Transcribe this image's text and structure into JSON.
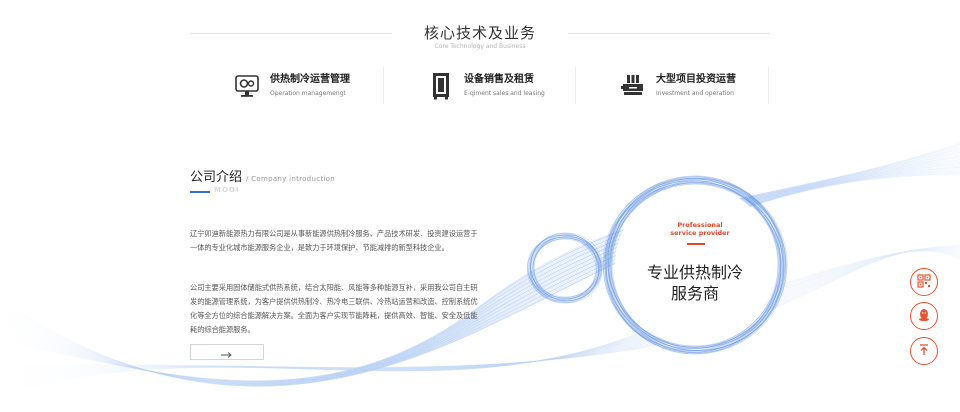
{
  "core": {
    "title": "核心技术及业务",
    "subtitle": "Core Technology and Business"
  },
  "services": [
    {
      "title": "供热制冷运营管理",
      "en": "Operation managemengt",
      "icon": "gear-monitor-icon"
    },
    {
      "title": "设备销售及租赁",
      "en": "E-qiment sales and leasing",
      "icon": "cabinet-icon"
    },
    {
      "title": "大型项目投资运营",
      "en": "Investment and operation",
      "icon": "machine-icon"
    }
  ],
  "intro": {
    "title": "公司介绍",
    "title_en": "/ Company introduction",
    "more_label": "MOOI",
    "para1": "辽宁卯迪新能源热力有限公司是从事新能源供热制冷服务、产品技术研发、投资建设运营于一体的专业化城市能源服务企业，是致力于环境保护、节能减排的新型科技企业。",
    "para2": "公司主要采用固体储能式供热系统，结合太阳能、风能等多种能源互补，采用我公司自主研发的能源管理系统，为客户提供供热制冷、热冷电三联供、冷热站运营和改造、控制系统优化等全方位的综合能源解决方案。全面为客户实现节能降耗，提供高效、智能、安全及低能耗的综合能源服务。",
    "button_icon": "arrow-right-icon"
  },
  "badge": {
    "en_line1": "Professional",
    "en_line2": "service provider",
    "cn_line1": "专业供热制冷",
    "cn_line2": "服务商"
  },
  "floating": [
    "qr-code-icon",
    "qq-icon",
    "back-to-top-icon"
  ],
  "colors": {
    "accent_red": "#e4482a",
    "accent_blue": "#3b6fd6",
    "ring_blue": "#5b8fe0"
  }
}
